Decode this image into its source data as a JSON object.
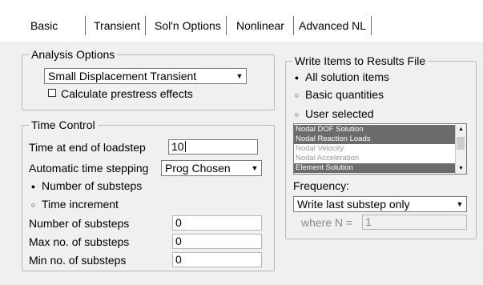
{
  "tabs": [
    {
      "label": "Basic"
    },
    {
      "label": "Transient"
    },
    {
      "label": "Sol'n Options"
    },
    {
      "label": "Nonlinear"
    },
    {
      "label": "Advanced NL"
    }
  ],
  "analysis_options": {
    "title": "Analysis Options",
    "analysis_type": "Small Displacement Transient",
    "prestress_label": "Calculate prestress effects",
    "prestress_checked": false
  },
  "time_control": {
    "title": "Time Control",
    "time_end_label": "Time at end of loadstep",
    "time_end_value": "10",
    "auto_step_label": "Automatic time stepping",
    "auto_step_value": "Prog Chosen",
    "radio_substeps_label": "Number of substeps",
    "radio_increment_label": "Time increment",
    "selected_radio": "substeps",
    "num_substeps_label": "Number of substeps",
    "num_substeps_value": "0",
    "max_substeps_label": "Max no. of substeps",
    "max_substeps_value": "0",
    "min_substeps_label": "Min no. of substeps",
    "min_substeps_value": "0"
  },
  "write_items": {
    "title": "Write Items to Results File",
    "radio_all_label": "All solution items",
    "radio_basic_label": "Basic quantities",
    "radio_user_label": "User selected",
    "selected_radio": "all",
    "list_items": [
      {
        "label": "Nodal DOF Solution",
        "selected": true
      },
      {
        "label": "Nodal Reaction Loads",
        "selected": true
      },
      {
        "label": "Nodal Velocity",
        "selected": false
      },
      {
        "label": "Nodal Acceleration",
        "selected": false
      },
      {
        "label": "Element Solution",
        "selected": true
      }
    ],
    "frequency_label": "Frequency:",
    "frequency_value": "Write last substep only",
    "where_n_label": "where N =",
    "where_n_value": "1"
  }
}
